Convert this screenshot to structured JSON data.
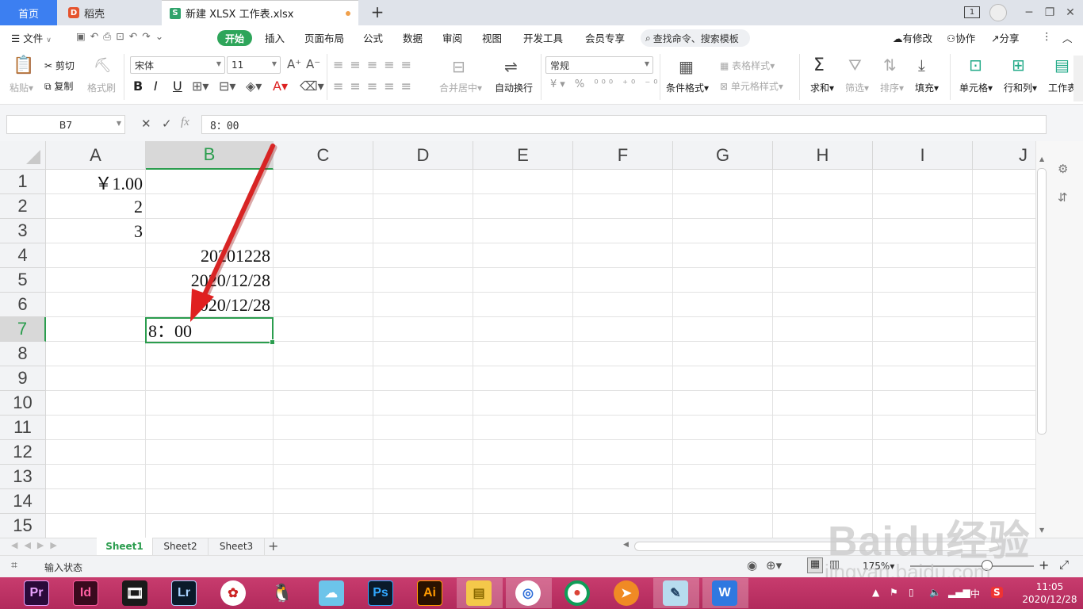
{
  "tabs": {
    "home": "首页",
    "daoke": "稻壳",
    "doc": "新建 XLSX 工作表.xlsx"
  },
  "titlebar": {
    "page_badge": "1"
  },
  "menu": {
    "file": "文件",
    "items": [
      "开始",
      "插入",
      "页面布局",
      "公式",
      "数据",
      "审阅",
      "视图",
      "开发工具",
      "会员专享"
    ],
    "search": "查找命令、搜索模板",
    "right": [
      "有修改",
      "协作",
      "分享"
    ]
  },
  "ribbon": {
    "paste": "粘贴",
    "cut": "剪切",
    "copy": "复制",
    "format_painter": "格式刷",
    "font_name": "宋体",
    "font_size": "11",
    "merge": "合并居中",
    "wrap": "自动换行",
    "number_format": "常规",
    "cond_format": "条件格式",
    "table_style": "表格样式",
    "cell_style": "单元格样式",
    "sum": "求和",
    "filter": "筛选",
    "sort": "排序",
    "fill": "填充",
    "cell": "单元格",
    "rowcol": "行和列",
    "worksheet": "工作表"
  },
  "formula_bar": {
    "name_box": "B7",
    "fx": "fx",
    "value": "8：00"
  },
  "grid": {
    "columns": [
      "A",
      "B",
      "C",
      "D",
      "E",
      "F",
      "G",
      "H",
      "I",
      "J"
    ],
    "rows": [
      "1",
      "2",
      "3",
      "4",
      "5",
      "6",
      "7",
      "8",
      "9",
      "10",
      "11",
      "12",
      "13",
      "14",
      "15"
    ],
    "selected_cell": "B7",
    "cells": {
      "A1": "￥1.00",
      "A2": "2",
      "A3": "3",
      "B4": "20201228",
      "B5": "2020/12/28",
      "B6": "2020/12/28",
      "B7": "8：00"
    }
  },
  "sheets": [
    "Sheet1",
    "Sheet2",
    "Sheet3"
  ],
  "status": {
    "mode": "输入状态",
    "zoom": "175%"
  },
  "taskbar": {
    "apps": [
      "Pr",
      "Id",
      "Lr",
      "Ps",
      "Ai"
    ],
    "time": "11:05",
    "date": "2020/12/28",
    "ime": "中"
  },
  "watermark": {
    "brand": "Baidu经验",
    "url": "jingyan.baidu.com"
  },
  "colors": {
    "accent_green": "#2b9d4e",
    "home_tab_blue": "#3c7ff1",
    "arrow_red": "#e02020",
    "taskbar": "#c13566"
  }
}
